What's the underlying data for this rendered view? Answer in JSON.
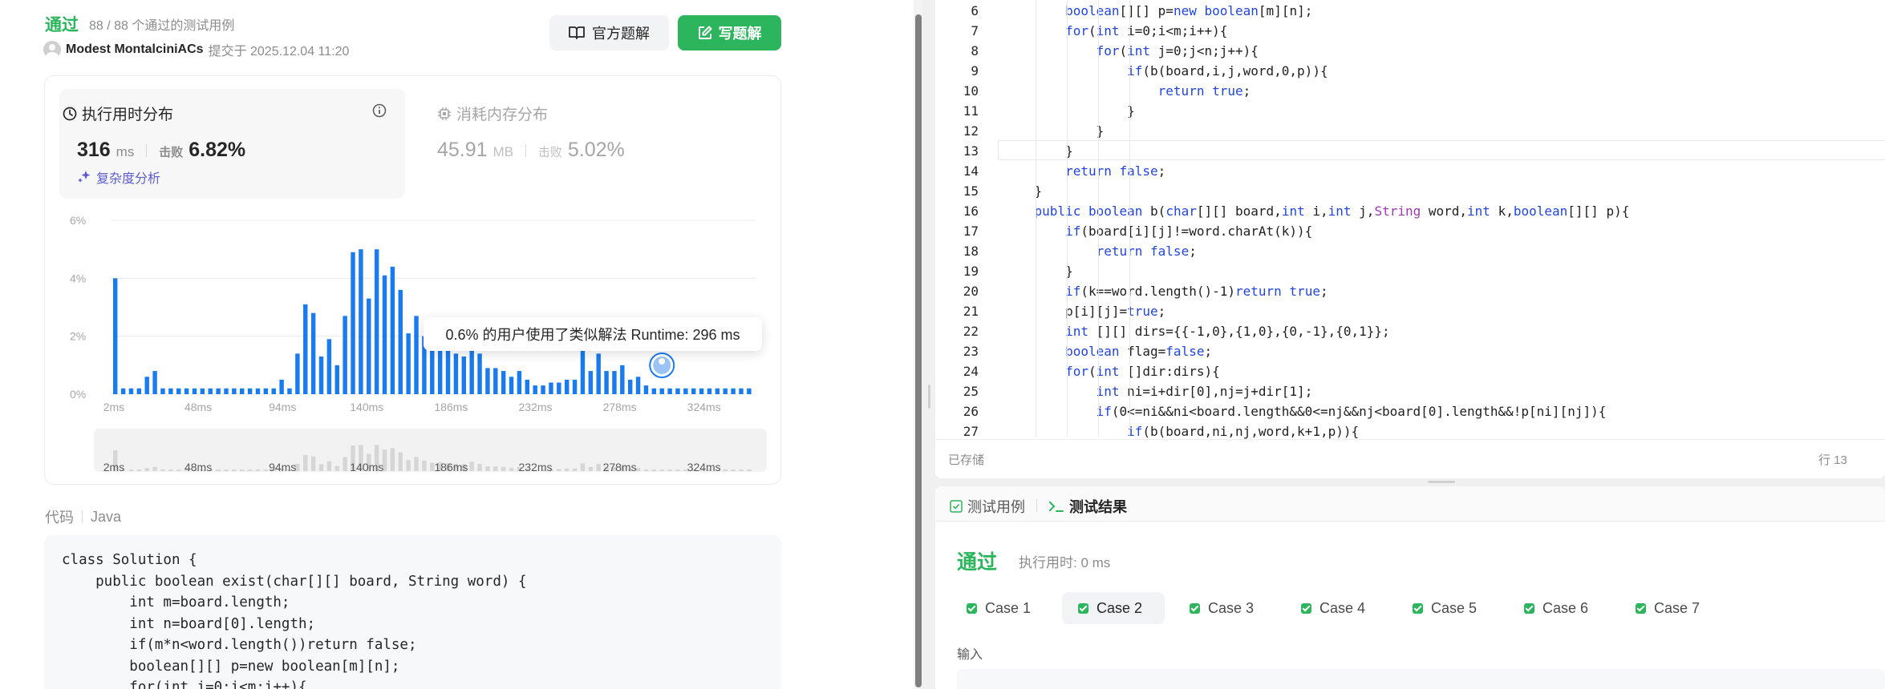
{
  "header": {
    "status": "通过",
    "status_detail": "88 / 88 个通过的测试用例",
    "author": "Modest MontalciniACs",
    "submitted": "提交于 2025.12.04 11:20",
    "btn_official": "官方题解",
    "btn_write": "写题解"
  },
  "runtime": {
    "title": "执行用时分布",
    "value": "316",
    "unit": "ms",
    "beat_label": "击败",
    "beat_value": "6.82%",
    "complexity_link": "复杂度分析"
  },
  "memory": {
    "title": "消耗内存分布",
    "value": "45.91",
    "unit": "MB",
    "beat_label": "击败",
    "beat_value": "5.02%"
  },
  "chart_data": {
    "type": "bar",
    "ylabel_ticks": [
      "6%",
      "4%",
      "2%",
      "0%"
    ],
    "ylim": [
      0,
      6
    ],
    "xtick_labels": [
      "2ms",
      "48ms",
      "94ms",
      "140ms",
      "186ms",
      "232ms",
      "278ms",
      "324ms"
    ],
    "bar_color": "#1a7aef",
    "values": [
      4.0,
      0.2,
      0.2,
      0.2,
      0.6,
      0.8,
      0.2,
      0.2,
      0.2,
      0.2,
      0.2,
      0.2,
      0.2,
      0.2,
      0.2,
      0.2,
      0.2,
      0.2,
      0.2,
      0.2,
      0.2,
      0.5,
      0.2,
      1.4,
      3.1,
      2.8,
      1.3,
      1.9,
      1.0,
      2.7,
      4.9,
      5.0,
      3.3,
      5.0,
      4.1,
      4.4,
      3.6,
      2.1,
      2.7,
      2.0,
      1.6,
      1.7,
      1.5,
      1.4,
      1.3,
      1.8,
      1.4,
      0.9,
      0.9,
      0.8,
      0.6,
      0.8,
      0.5,
      0.3,
      0.3,
      0.4,
      0.4,
      0.5,
      0.5,
      1.5,
      0.8,
      1.4,
      0.8,
      0.8,
      1.0,
      0.5,
      0.6,
      0.3,
      0.2,
      0.2,
      0.2,
      0.2,
      0.2,
      0.2,
      0.2,
      0.2,
      0.2,
      0.2,
      0.2,
      0.2,
      0.2
    ],
    "tooltip": "0.6% 的用户使用了类似解法 Runtime: 296 ms",
    "highlight_index": 69
  },
  "code_header": {
    "label": "代码",
    "language": "Java"
  },
  "submitted_code": "class Solution {\n    public boolean exist(char[][] board, String word) {\n        int m=board.length;\n        int n=board[0].length;\n        if(m*n<word.length())return false;\n        boolean[][] p=new boolean[m][n];\n        for(int i=0;i<m;i++){",
  "editor": {
    "status": "已存储",
    "position": "行 13",
    "start_line": 6,
    "lines": [
      "        boolean[][] p=new boolean[m][n];",
      "        for(int i=0;i<m;i++){",
      "            for(int j=0;j<n;j++){",
      "                if(b(board,i,j,word,0,p)){",
      "                    return true;",
      "                }",
      "            }",
      "        }",
      "        return false;",
      "    }",
      "    public boolean b(char[][] board,int i,int j,String word,int k,boolean[][] p){",
      "        if(board[i][j]!=word.charAt(k)){",
      "            return false;",
      "        }",
      "        if(k==word.length()-1)return true;",
      "        p[i][j]=true;",
      "        int [][] dirs={{-1,0},{1,0},{0,-1},{0,1}};",
      "        boolean flag=false;",
      "        for(int []dir:dirs){",
      "            int ni=i+dir[0],nj=j+dir[1];",
      "            if(0<=ni&&ni<board.length&&0<=nj&&nj<board[0].length&&!p[ni][nj]){",
      "                if(b(board,ni,nj,word,k+1,p)){"
    ]
  },
  "results": {
    "tab_testcase": "测试用例",
    "tab_result": "测试结果",
    "status": "通过",
    "time": "执行用时: 0 ms",
    "cases": [
      "Case 1",
      "Case 2",
      "Case 3",
      "Case 4",
      "Case 5",
      "Case 6",
      "Case 7"
    ],
    "active_case": 1,
    "input_label": "输入"
  },
  "colors": {
    "accent_green": "#2db55d",
    "bar_blue": "#1a7aef",
    "purple": "#5c5ccf"
  }
}
